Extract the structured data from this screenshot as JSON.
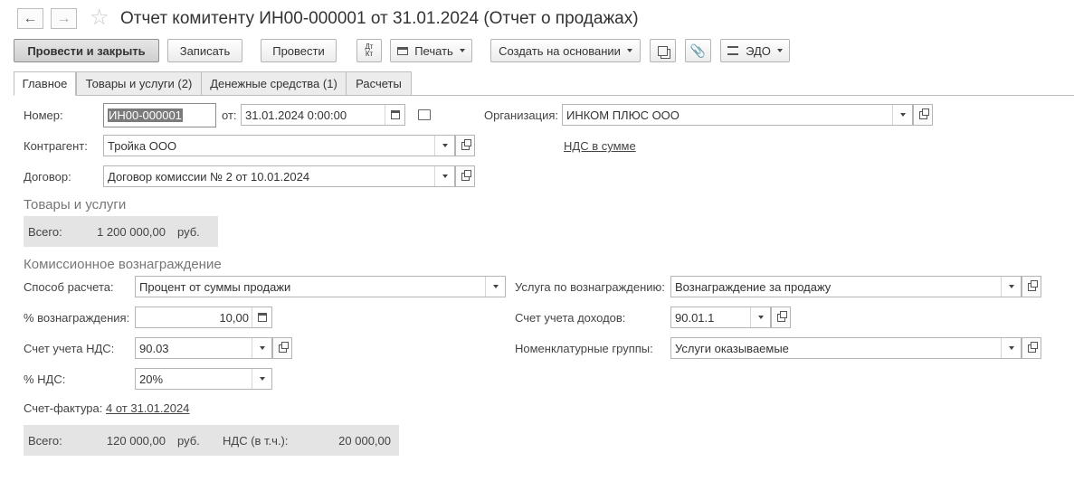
{
  "window": {
    "title": "Отчет комитенту ИН00-000001 от 31.01.2024 (Отчет о продажах)"
  },
  "toolbar": {
    "post_close": "Провести и закрыть",
    "save": "Записать",
    "post": "Провести",
    "dt_kt": "Дт\nКт",
    "print": "Печать",
    "create_based": "Создать на основании",
    "edo": "ЭДО"
  },
  "tabs": [
    "Главное",
    "Товары и услуги (2)",
    "Денежные средства (1)",
    "Расчеты"
  ],
  "header": {
    "number_label": "Номер:",
    "number_value": "ИН00-000001",
    "date_label": "от:",
    "date_value": "31.01.2024  0:00:00",
    "org_label": "Организация:",
    "org_value": "ИНКОМ ПЛЮС ООО",
    "contractor_label": "Контрагент:",
    "contractor_value": "Тройка ООО",
    "vat_link": "НДС в сумме",
    "contract_label": "Договор:",
    "contract_value": "Договор комиссии № 2 от 10.01.2024"
  },
  "goods": {
    "section_title": "Товары и услуги",
    "total_label": "Всего:",
    "total_value": "1 200 000,00",
    "currency": "руб."
  },
  "commission": {
    "section_title": "Комиссионное вознаграждение",
    "calc_method_label": "Способ расчета:",
    "calc_method_value": "Процент от суммы продажи",
    "service_label": "Услуга по вознаграждению:",
    "service_value": "Вознаграждение за продажу",
    "percent_label": "% вознаграждения:",
    "percent_value": "10,00",
    "income_account_label": "Счет учета доходов:",
    "income_account_value": "90.01.1",
    "vat_account_label": "Счет учета НДС:",
    "vat_account_value": "90.03",
    "nomenclature_groups_label": "Номенклатурные группы:",
    "nomenclature_groups_value": "Услуги оказываемые",
    "vat_rate_label": "% НДС:",
    "vat_rate_value": "20%",
    "invoice_label": "Счет-фактура:",
    "invoice_link": "4 от 31.01.2024",
    "total_label": "Всего:",
    "total_value": "120 000,00",
    "currency": "руб.",
    "vat_incl_label": "НДС (в т.ч.):",
    "vat_incl_value": "20 000,00"
  }
}
